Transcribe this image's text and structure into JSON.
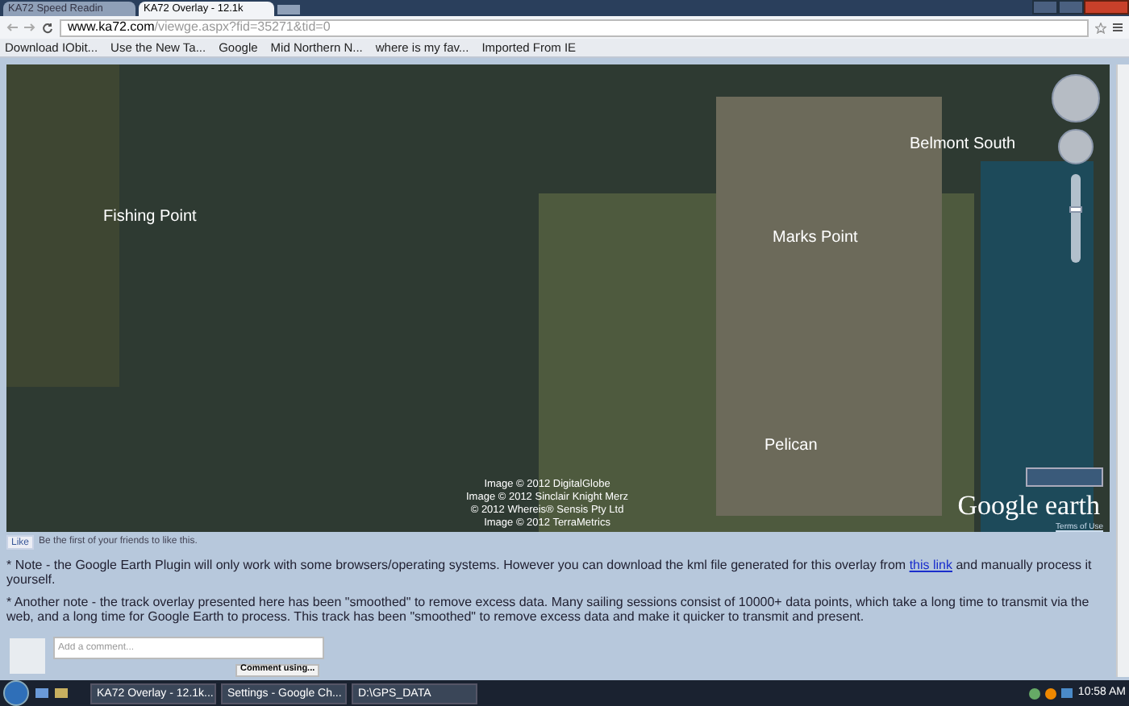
{
  "browser": {
    "tabs": [
      {
        "title": "KA72 Speed Readin",
        "selected": false
      },
      {
        "title": "KA72 Overlay - 12.1k",
        "selected": true
      }
    ],
    "address": {
      "domain": "www.ka72.com",
      "path": "/viewge.aspx?fid=35271&tid=0"
    },
    "bookmarks": [
      "Download IObit...",
      "Use the New Ta...",
      "Google",
      "Mid Northern N...",
      "where is my fav...",
      "Imported From IE"
    ]
  },
  "map": {
    "labels": [
      {
        "text": "Fishing Point",
        "kind": "place"
      },
      {
        "text": "Marks Point",
        "kind": "place"
      },
      {
        "text": "Belmont South",
        "kind": "place"
      },
      {
        "text": "Pelican",
        "kind": "place"
      }
    ],
    "credits": [
      "Image © 2012 DigitalGlobe",
      "Image © 2012 Sinclair Knight Merz",
      "© 2012 Whereis® Sensis Pty Ltd",
      "Image © 2012 TerraMetrics"
    ],
    "logo": "Google earth",
    "terms": "Terms of Use",
    "zoom": {
      "level": 0.6
    }
  },
  "like": {
    "button": "Like",
    "text": "Be the first of your friends to like this."
  },
  "notes": [
    {
      "before": "* Note - the Google Earth Plugin will only work with some browsers/operating systems. However you can download the kml file generated for this overlay from ",
      "link": "this link",
      "after": " and manually process it yourself."
    },
    {
      "before": "* Another note - the track overlay presented here has been \"smoothed\" to remove excess data. Many sailing sessions consist of 10000+ data points, which take a long time to transmit via the web, and a long time for Google Earth to process. This track has been \"smoothed\" to remove excess data and make it quicker to transmit and present."
    }
  ],
  "comment": {
    "placeholder": "Add a comment...",
    "button": "Comment using..."
  },
  "taskbar": {
    "windows": [
      "KA72 Overlay - 12.1k...",
      "Settings - Google Ch...",
      "D:\\GPS_DATA"
    ],
    "clock": "10:58 AM"
  }
}
